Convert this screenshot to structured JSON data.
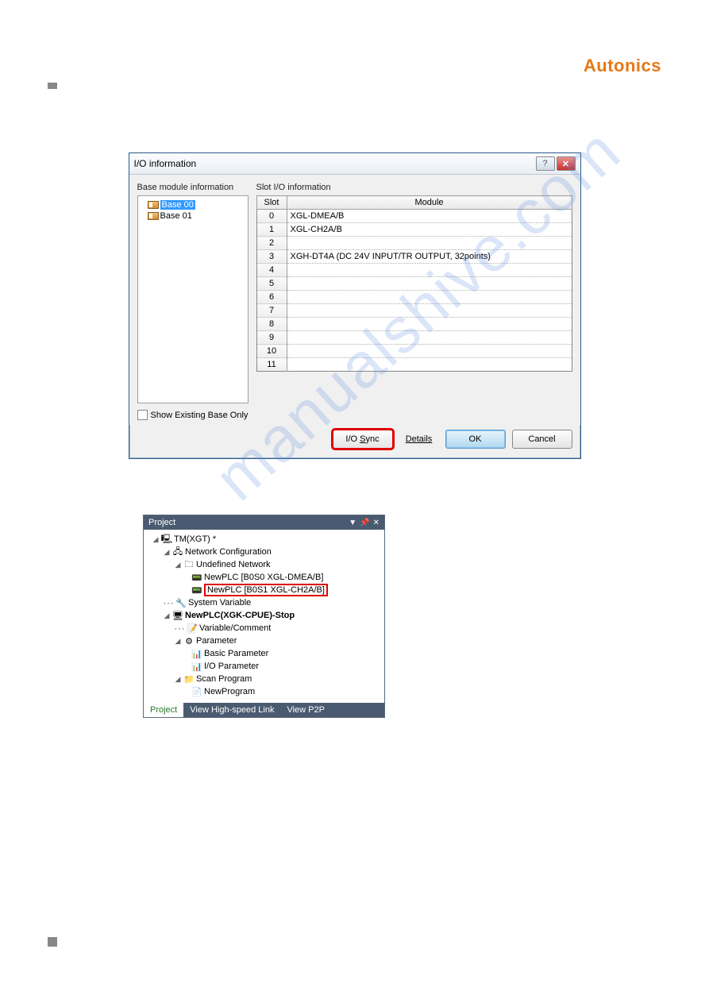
{
  "brand": "Autonics",
  "dialog": {
    "title": "I/O information",
    "left_label": "Base module information",
    "right_label": "Slot I/O information",
    "tree_items": [
      "Base 00",
      "Base 01"
    ],
    "table": {
      "headers": [
        "Slot",
        "Module"
      ],
      "rows": [
        {
          "slot": "0",
          "module": "XGL-DMEA/B"
        },
        {
          "slot": "1",
          "module": "XGL-CH2A/B"
        },
        {
          "slot": "2",
          "module": ""
        },
        {
          "slot": "3",
          "module": "XGH-DT4A (DC 24V INPUT/TR OUTPUT, 32points)"
        },
        {
          "slot": "4",
          "module": ""
        },
        {
          "slot": "5",
          "module": ""
        },
        {
          "slot": "6",
          "module": ""
        },
        {
          "slot": "7",
          "module": ""
        },
        {
          "slot": "8",
          "module": ""
        },
        {
          "slot": "9",
          "module": ""
        },
        {
          "slot": "10",
          "module": ""
        },
        {
          "slot": "11",
          "module": ""
        }
      ]
    },
    "checkbox_label": "Show Existing Base Only",
    "buttons": {
      "sync": "I/O Sync",
      "details": "Details",
      "ok": "OK",
      "cancel": "Cancel"
    }
  },
  "project": {
    "title": "Project",
    "tabs": {
      "project": "Project",
      "hsl": "View High-speed Link",
      "p2p": "View P2P"
    },
    "nodes": {
      "root": "TM(XGT) *",
      "netconf": "Network Configuration",
      "undefnet": "Undefined Network",
      "plc0": "NewPLC [B0S0 XGL-DMEA/B]",
      "plc1": "NewPLC [B0S1 XGL-CH2A/B]",
      "sysvar": "System Variable",
      "newplc": "NewPLC(XGK-CPUE)-Stop",
      "varcomment": "Variable/Comment",
      "param": "Parameter",
      "basicparam": "Basic Parameter",
      "ioparam": "I/O Parameter",
      "scanprog": "Scan Program",
      "newprog": "NewProgram"
    }
  },
  "watermark": "manualshive.com"
}
